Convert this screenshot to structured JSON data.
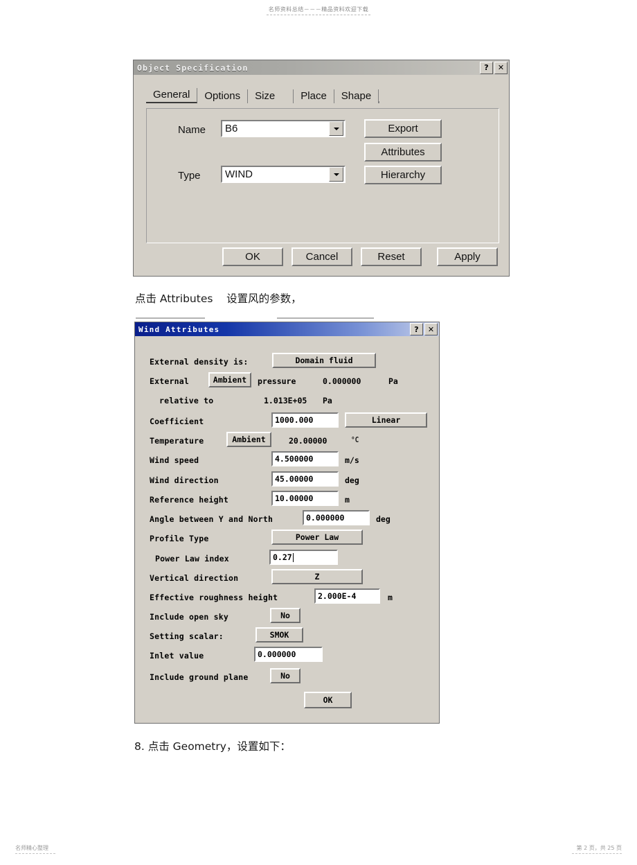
{
  "page": {
    "header_text": "名师资料总结－－－精品资料欢迎下载",
    "footer_left": "名师精心整理",
    "footer_right": "第 2 页，共 25 页"
  },
  "captions": {
    "after_first_dialog": "点击 Attributes    设置风的参数，",
    "after_second_dialog": "8. 点击 Geometry，设置如下："
  },
  "object_dialog": {
    "title": "Object Specification",
    "help_button": "?",
    "close_button": "✕",
    "tabs": [
      {
        "label": "General",
        "selected": true
      },
      {
        "label": "Options",
        "selected": false
      },
      {
        "label": "Size",
        "selected": false
      },
      {
        "label": "Place",
        "selected": false
      },
      {
        "label": "Shape",
        "selected": false
      }
    ],
    "fields": [
      {
        "label": "Name",
        "value": "B6"
      },
      {
        "label": "Type",
        "value": "WIND"
      }
    ],
    "side_buttons": [
      "Export",
      "Attributes",
      "Hierarchy"
    ],
    "footer_buttons": [
      "OK",
      "Cancel",
      "Reset",
      "Apply"
    ]
  },
  "wind_dialog": {
    "title": "Wind Attributes",
    "help_button": "?",
    "close_button": "✕",
    "rows": {
      "external_density_label": "External density is:",
      "external_density_button": "Domain fluid",
      "external_label": "External",
      "external_ambient_button": "Ambient",
      "external_pressure_label": "pressure",
      "external_pressure_value": "0.000000",
      "external_pressure_unit": "Pa",
      "relative_to_label": "relative to",
      "relative_to_value": "1.013E+05",
      "relative_to_unit": "Pa",
      "coefficient_label": "Coefficient",
      "coefficient_value": "1000.000",
      "coefficient_button": "Linear",
      "temperature_label": "Temperature",
      "temperature_button": "Ambient",
      "temperature_value": "20.00000",
      "temperature_unit": "°C",
      "wind_speed_label": "Wind speed",
      "wind_speed_value": "4.500000",
      "wind_speed_unit": "m/s",
      "wind_direction_label": "Wind direction",
      "wind_direction_value": "45.00000",
      "wind_direction_unit": "deg",
      "reference_height_label": "Reference height",
      "reference_height_value": "10.00000",
      "reference_height_unit": "m",
      "angle_north_label": "Angle between Y and North",
      "angle_north_value": "0.000000",
      "angle_north_unit": "deg",
      "profile_type_label": "Profile Type",
      "profile_type_button": "Power Law",
      "power_law_index_label": "Power Law index",
      "power_law_index_value": "0.27",
      "vertical_direction_label": "Vertical direction",
      "vertical_direction_button": "Z",
      "roughness_label": "Effective roughness height",
      "roughness_value": "2.000E-4",
      "roughness_unit": "m",
      "open_sky_label": "Include open sky",
      "open_sky_button": "No",
      "setting_scalar_label": "Setting scalar:",
      "setting_scalar_button": "SMOK",
      "inlet_value_label": "Inlet value",
      "inlet_value_value": "0.000000",
      "ground_plane_label": "Include ground plane",
      "ground_plane_button": "No",
      "ok_button": "OK"
    }
  }
}
